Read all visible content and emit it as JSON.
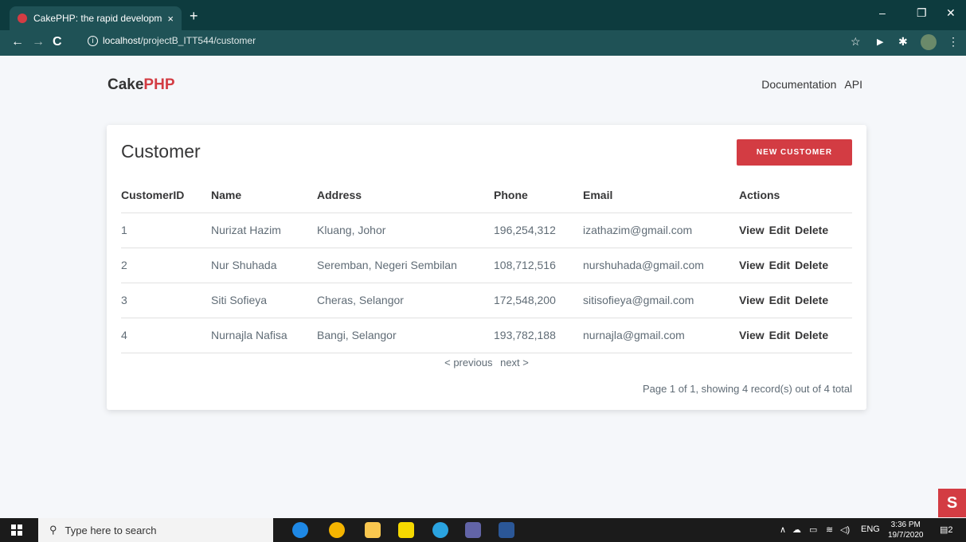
{
  "browser": {
    "tab_title": "CakePHP: the rapid development",
    "tab_close": "×",
    "new_tab": "+",
    "url_host": "localhost",
    "url_path": "/projectB_ITT544/customer"
  },
  "header": {
    "brand_cake": "Cake",
    "brand_php": "PHP",
    "nav": [
      "Documentation",
      "API"
    ]
  },
  "main": {
    "title": "Customer",
    "new_button": "NEW CUSTOMER",
    "columns": [
      "CustomerID",
      "Name",
      "Address",
      "Phone",
      "Email",
      "Actions"
    ],
    "rows": [
      {
        "id": "1",
        "name": "Nurizat Hazim",
        "address": "Kluang, Johor",
        "phone": "196,254,312",
        "email": "izathazim@gmail.com"
      },
      {
        "id": "2",
        "name": "Nur Shuhada",
        "address": "Seremban, Negeri Sembilan",
        "phone": "108,712,516",
        "email": "nurshuhada@gmail.com"
      },
      {
        "id": "3",
        "name": "Siti Sofieya",
        "address": "Cheras, Selangor",
        "phone": "172,548,200",
        "email": "sitisofieya@gmail.com"
      },
      {
        "id": "4",
        "name": "Nurnajla Nafisa",
        "address": "Bangi, Selangor",
        "phone": "193,782,188",
        "email": "nurnajla@gmail.com"
      }
    ],
    "actions": [
      "View",
      "Edit",
      "Delete"
    ],
    "paginator": {
      "previous": "< previous",
      "next": "next >"
    },
    "counter": "Page 1 of 1, showing 4 record(s) out of 4 total"
  },
  "taskbar": {
    "search_placeholder": "Type here to search",
    "language": "ENG",
    "time": "3:36 PM",
    "date": "19/7/2020",
    "notifications": "2"
  },
  "colors": {
    "accent": "#d33c43",
    "chrome": "#0d3b3e"
  }
}
